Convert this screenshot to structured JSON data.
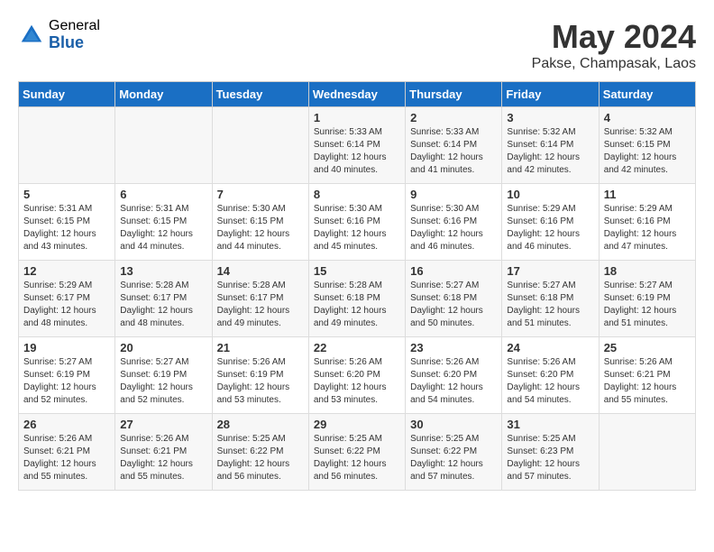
{
  "header": {
    "logo_general": "General",
    "logo_blue": "Blue",
    "month_title": "May 2024",
    "location": "Pakse, Champasak, Laos"
  },
  "calendar": {
    "days_of_week": [
      "Sunday",
      "Monday",
      "Tuesday",
      "Wednesday",
      "Thursday",
      "Friday",
      "Saturday"
    ],
    "weeks": [
      [
        {
          "day": "",
          "info": ""
        },
        {
          "day": "",
          "info": ""
        },
        {
          "day": "",
          "info": ""
        },
        {
          "day": "1",
          "info": "Sunrise: 5:33 AM\nSunset: 6:14 PM\nDaylight: 12 hours\nand 40 minutes."
        },
        {
          "day": "2",
          "info": "Sunrise: 5:33 AM\nSunset: 6:14 PM\nDaylight: 12 hours\nand 41 minutes."
        },
        {
          "day": "3",
          "info": "Sunrise: 5:32 AM\nSunset: 6:14 PM\nDaylight: 12 hours\nand 42 minutes."
        },
        {
          "day": "4",
          "info": "Sunrise: 5:32 AM\nSunset: 6:15 PM\nDaylight: 12 hours\nand 42 minutes."
        }
      ],
      [
        {
          "day": "5",
          "info": "Sunrise: 5:31 AM\nSunset: 6:15 PM\nDaylight: 12 hours\nand 43 minutes."
        },
        {
          "day": "6",
          "info": "Sunrise: 5:31 AM\nSunset: 6:15 PM\nDaylight: 12 hours\nand 44 minutes."
        },
        {
          "day": "7",
          "info": "Sunrise: 5:30 AM\nSunset: 6:15 PM\nDaylight: 12 hours\nand 44 minutes."
        },
        {
          "day": "8",
          "info": "Sunrise: 5:30 AM\nSunset: 6:16 PM\nDaylight: 12 hours\nand 45 minutes."
        },
        {
          "day": "9",
          "info": "Sunrise: 5:30 AM\nSunset: 6:16 PM\nDaylight: 12 hours\nand 46 minutes."
        },
        {
          "day": "10",
          "info": "Sunrise: 5:29 AM\nSunset: 6:16 PM\nDaylight: 12 hours\nand 46 minutes."
        },
        {
          "day": "11",
          "info": "Sunrise: 5:29 AM\nSunset: 6:16 PM\nDaylight: 12 hours\nand 47 minutes."
        }
      ],
      [
        {
          "day": "12",
          "info": "Sunrise: 5:29 AM\nSunset: 6:17 PM\nDaylight: 12 hours\nand 48 minutes."
        },
        {
          "day": "13",
          "info": "Sunrise: 5:28 AM\nSunset: 6:17 PM\nDaylight: 12 hours\nand 48 minutes."
        },
        {
          "day": "14",
          "info": "Sunrise: 5:28 AM\nSunset: 6:17 PM\nDaylight: 12 hours\nand 49 minutes."
        },
        {
          "day": "15",
          "info": "Sunrise: 5:28 AM\nSunset: 6:18 PM\nDaylight: 12 hours\nand 49 minutes."
        },
        {
          "day": "16",
          "info": "Sunrise: 5:27 AM\nSunset: 6:18 PM\nDaylight: 12 hours\nand 50 minutes."
        },
        {
          "day": "17",
          "info": "Sunrise: 5:27 AM\nSunset: 6:18 PM\nDaylight: 12 hours\nand 51 minutes."
        },
        {
          "day": "18",
          "info": "Sunrise: 5:27 AM\nSunset: 6:19 PM\nDaylight: 12 hours\nand 51 minutes."
        }
      ],
      [
        {
          "day": "19",
          "info": "Sunrise: 5:27 AM\nSunset: 6:19 PM\nDaylight: 12 hours\nand 52 minutes."
        },
        {
          "day": "20",
          "info": "Sunrise: 5:27 AM\nSunset: 6:19 PM\nDaylight: 12 hours\nand 52 minutes."
        },
        {
          "day": "21",
          "info": "Sunrise: 5:26 AM\nSunset: 6:19 PM\nDaylight: 12 hours\nand 53 minutes."
        },
        {
          "day": "22",
          "info": "Sunrise: 5:26 AM\nSunset: 6:20 PM\nDaylight: 12 hours\nand 53 minutes."
        },
        {
          "day": "23",
          "info": "Sunrise: 5:26 AM\nSunset: 6:20 PM\nDaylight: 12 hours\nand 54 minutes."
        },
        {
          "day": "24",
          "info": "Sunrise: 5:26 AM\nSunset: 6:20 PM\nDaylight: 12 hours\nand 54 minutes."
        },
        {
          "day": "25",
          "info": "Sunrise: 5:26 AM\nSunset: 6:21 PM\nDaylight: 12 hours\nand 55 minutes."
        }
      ],
      [
        {
          "day": "26",
          "info": "Sunrise: 5:26 AM\nSunset: 6:21 PM\nDaylight: 12 hours\nand 55 minutes."
        },
        {
          "day": "27",
          "info": "Sunrise: 5:26 AM\nSunset: 6:21 PM\nDaylight: 12 hours\nand 55 minutes."
        },
        {
          "day": "28",
          "info": "Sunrise: 5:25 AM\nSunset: 6:22 PM\nDaylight: 12 hours\nand 56 minutes."
        },
        {
          "day": "29",
          "info": "Sunrise: 5:25 AM\nSunset: 6:22 PM\nDaylight: 12 hours\nand 56 minutes."
        },
        {
          "day": "30",
          "info": "Sunrise: 5:25 AM\nSunset: 6:22 PM\nDaylight: 12 hours\nand 57 minutes."
        },
        {
          "day": "31",
          "info": "Sunrise: 5:25 AM\nSunset: 6:23 PM\nDaylight: 12 hours\nand 57 minutes."
        },
        {
          "day": "",
          "info": ""
        }
      ]
    ]
  }
}
